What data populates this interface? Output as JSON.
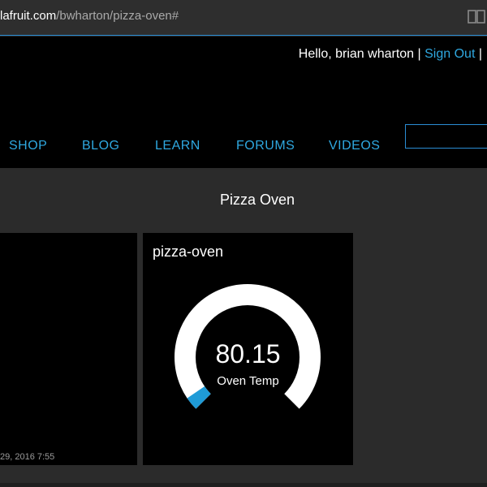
{
  "browser": {
    "url_host": "lafruit.com",
    "url_path": "/bwharton/pizza-oven#",
    "reader_icon": "book-icon"
  },
  "header": {
    "greeting": "Hello, brian wharton",
    "separator": "|",
    "sign_out": "Sign Out",
    "trailing_separator": "|"
  },
  "nav": {
    "items": [
      {
        "label": "SHOP"
      },
      {
        "label": "BLOG"
      },
      {
        "label": "LEARN"
      },
      {
        "label": "FORUMS"
      },
      {
        "label": "VIDEOS"
      }
    ]
  },
  "page": {
    "title": "Pizza Oven"
  },
  "left_card": {
    "timestamp": "29, 2016 7:55"
  },
  "gauge_card": {
    "title": "pizza-oven",
    "value": "80.15",
    "label": "Oven Temp",
    "fill_fraction": 0.04,
    "colors": {
      "track": "#ffffff",
      "fill": "#1f9bd7",
      "accent": "#2fa8e0"
    }
  }
}
